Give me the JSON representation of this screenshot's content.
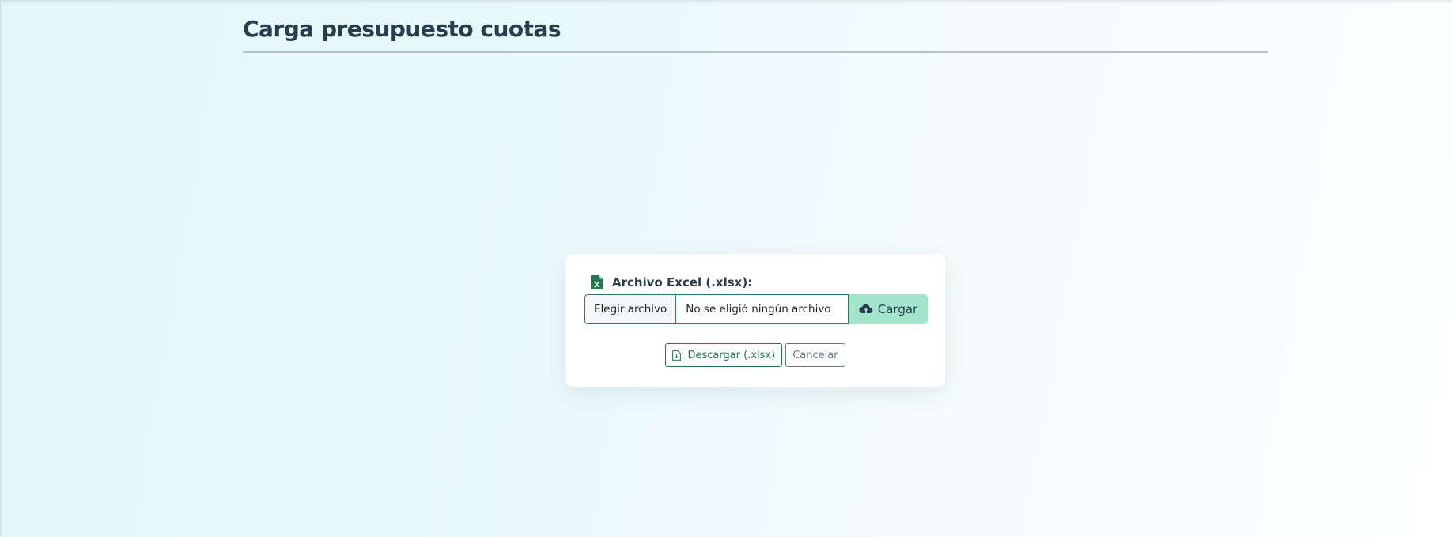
{
  "page": {
    "title": "Carga presupuesto cuotas"
  },
  "upload_card": {
    "field_label": "Archivo Excel (.xlsx):",
    "label_icon": "excel-file-icon",
    "file_input": {
      "choose_label": "Elegir archivo",
      "status_text": "No se eligió ningún archivo"
    },
    "upload_button": {
      "label": "Cargar",
      "icon": "cloud-upload-icon"
    },
    "download_button": {
      "label": "Descargar (.xlsx)",
      "icon": "file-download-icon"
    },
    "cancel_button": {
      "label": "Cancelar"
    }
  },
  "colors": {
    "accent_green": "#1e7c4c",
    "upload_button_bg": "#a3e4cc",
    "title_text": "#2a3d4f",
    "secondary_gray": "#6c757d"
  }
}
